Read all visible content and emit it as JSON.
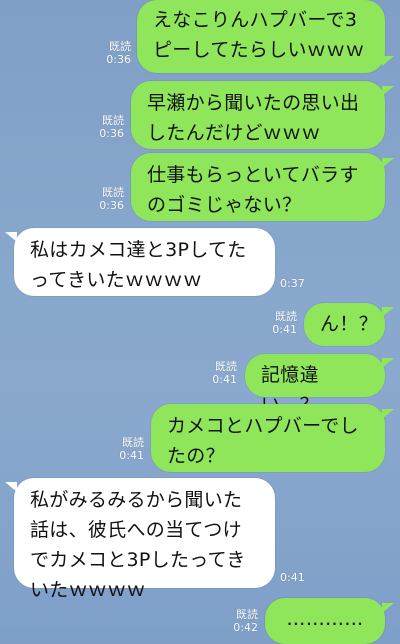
{
  "messages": [
    {
      "side": "sent",
      "text": "えなこりんハプバーで3ピーしてたらしいｗｗｗ",
      "read": "既読",
      "time": "0:36"
    },
    {
      "side": "sent",
      "text": "早瀬から聞いたの思い出したんだけどｗｗｗ",
      "read": "既読",
      "time": "0:36"
    },
    {
      "side": "sent",
      "text": "仕事もらっといてバラすのゴミじゃない？",
      "read": "既読",
      "time": "0:36"
    },
    {
      "side": "recv",
      "text": "私はカメコ達と3Pしてたってきいたｗｗｗｗ",
      "time": "0:37"
    },
    {
      "side": "sent",
      "text": "ん！？",
      "read": "既読",
      "time": "0:41"
    },
    {
      "side": "sent",
      "text": "記憶違い…？",
      "read": "既読",
      "time": "0:41"
    },
    {
      "side": "sent",
      "text": "カメコとハプバーでしたの？",
      "read": "既読",
      "time": "0:41"
    },
    {
      "side": "recv",
      "text": "私がみるみるから聞いた話は、彼氏への当てつけでカメコと3Pしたってきいたｗｗｗｗ",
      "time": "0:41"
    },
    {
      "side": "sent",
      "text": "…………",
      "read": "既読",
      "time": "0:42"
    }
  ]
}
